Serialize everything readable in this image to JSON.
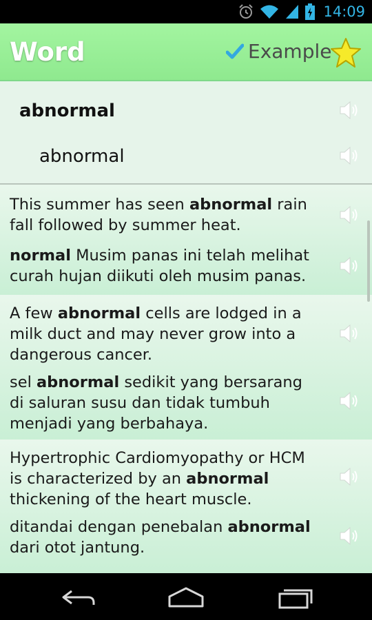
{
  "status_bar": {
    "time": "14:09",
    "icons": [
      "alarm-icon",
      "wifi-icon",
      "signal-icon",
      "battery-charging-icon"
    ]
  },
  "header": {
    "title": "Word",
    "example_label": "Example",
    "example_checked": true,
    "favorite_icon": "star-icon"
  },
  "word": {
    "term": "abnormal",
    "translation": "abnormal"
  },
  "examples": [
    {
      "english": [
        {
          "t": "This summer has seen ",
          "b": false
        },
        {
          "t": "abnormal",
          "b": true
        },
        {
          "t": " rain fall followed by summer heat.",
          "b": false
        }
      ],
      "indonesian": [
        {
          "t": "normal",
          "b": true
        },
        {
          "t": " Musim panas ini telah melihat curah hujan diikuti oleh musim panas.",
          "b": false
        }
      ]
    },
    {
      "english": [
        {
          "t": "A few ",
          "b": false
        },
        {
          "t": "abnormal",
          "b": true
        },
        {
          "t": " cells are lodged in a milk duct and may never grow into a dangerous cancer.",
          "b": false
        }
      ],
      "indonesian": [
        {
          "t": "sel ",
          "b": false
        },
        {
          "t": "abnormal",
          "b": true
        },
        {
          "t": " sedikit yang bersarang di saluran susu dan tidak tumbuh menjadi yang berbahaya.",
          "b": false
        }
      ]
    },
    {
      "english": [
        {
          "t": "Hypertrophic Cardiomyopathy or HCM is characterized by an ",
          "b": false
        },
        {
          "t": "abnormal",
          "b": true
        },
        {
          "t": " thickening of the heart muscle.",
          "b": false
        }
      ],
      "indonesian": [
        {
          "t": "ditandai dengan penebalan ",
          "b": false
        },
        {
          "t": "abnormal",
          "b": true
        },
        {
          "t": " dari otot jantung.",
          "b": false
        }
      ]
    }
  ],
  "nav_bar": {
    "icons": [
      "back-icon",
      "home-icon",
      "recent-apps-icon"
    ]
  },
  "colors": {
    "header_green": "#a3f5a0",
    "row_green": "#e6f4ea",
    "accent_blue": "#33b5e5",
    "star_yellow": "#f5e71c"
  }
}
